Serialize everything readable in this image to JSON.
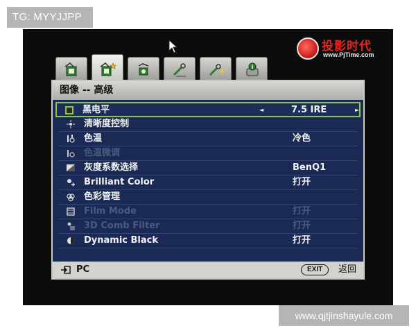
{
  "watermarks": {
    "top_left": "TG: MYYJJPP",
    "bottom_right": "www.qjtjinshayule.com"
  },
  "logo": {
    "title": "投影时代",
    "url": "www.PjTime.com"
  },
  "tabs": [
    {
      "icon": "picture-icon",
      "active": false
    },
    {
      "icon": "picture-advanced-icon",
      "active": true
    },
    {
      "icon": "audio-icon",
      "active": false
    },
    {
      "icon": "display-settings-icon",
      "active": false
    },
    {
      "icon": "system-settings-icon",
      "active": false
    },
    {
      "icon": "information-icon",
      "active": false
    }
  ],
  "panel": {
    "title": "图像 -- 高级",
    "items": [
      {
        "label": "黑电平",
        "value": "7.5 IRE",
        "icon": "black-level-icon"
      },
      {
        "label": "清晰度控制",
        "value": "",
        "icon": "sharpness-icon"
      },
      {
        "label": "色温",
        "value": "冷色",
        "icon": "color-temperature-icon"
      },
      {
        "label": "色温微调",
        "value": "",
        "icon": "color-temperature-tune-icon"
      },
      {
        "label": "灰度系数选择",
        "value": "BenQ1",
        "icon": "gamma-icon"
      },
      {
        "label": "Brilliant Color",
        "value": "打开",
        "icon": "brilliant-color-icon"
      },
      {
        "label": "色彩管理",
        "value": "",
        "icon": "color-management-icon"
      },
      {
        "label": "Film Mode",
        "value": "打开",
        "icon": "film-mode-icon"
      },
      {
        "label": "3D Comb Filter",
        "value": "打开",
        "icon": "comb-filter-icon"
      },
      {
        "label": "Dynamic Black",
        "value": "打开",
        "icon": "dynamic-black-icon"
      }
    ],
    "arrow_left": "◄",
    "arrow_right": "►"
  },
  "footer": {
    "source_label": "PC",
    "exit_button": "EXIT",
    "exit_label": "返回"
  },
  "colors": {
    "panel_bg": "#1b2a55",
    "selection_border": "#8ec63f",
    "disabled_text": "#4c5a82",
    "logo_red": "#e0261f"
  }
}
